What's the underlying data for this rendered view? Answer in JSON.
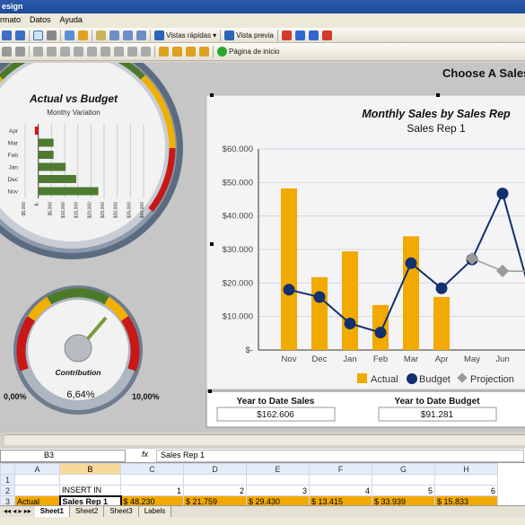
{
  "window": {
    "title": "esign"
  },
  "menu": [
    "rmato",
    "Datos",
    "Ayuda"
  ],
  "toolbar1": {
    "vistas": "Vistas rápidas",
    "vista_previa": "Vista previa"
  },
  "toolbar2": {
    "home": "Página de inicio"
  },
  "dashboard": {
    "choose_title": "Choose A Sales",
    "budget_gauge": {
      "title": "Actual vs Budget",
      "subtitle": "Monthy Variation",
      "categories": [
        "Apr",
        "Mar",
        "Feb",
        "Jan",
        "Dec",
        "Nov"
      ],
      "x_ticks": [
        "-$5,000",
        "$-",
        "$5,000",
        "$10,000",
        "$15,000",
        "$20,000",
        "$25,000",
        "$30,000",
        "$35,000",
        "$40,000"
      ],
      "values": [
        -1300,
        5800,
        5800,
        10400,
        14400,
        22800
      ]
    },
    "contribution": {
      "label": "Contribution",
      "value": "6,64%",
      "min": "0,00%",
      "max": "10,00%"
    },
    "ytd_sales": {
      "label": "Year to Date Sales",
      "value": "$162.606"
    },
    "ytd_budget": {
      "label": "Year to Date Budget",
      "value": "$91.281"
    }
  },
  "chart_data": {
    "type": "bar",
    "title": "Monthly Sales by Sales Rep",
    "subtitle": "Sales Rep 1",
    "categories": [
      "Nov",
      "Dec",
      "Jan",
      "Feb",
      "Mar",
      "Apr",
      "May",
      "Jun"
    ],
    "ylim": [
      0,
      60000
    ],
    "y_ticks": [
      "$-",
      "$10.000",
      "$20.000",
      "$30.000",
      "$40.000",
      "$50.000",
      "$60.000"
    ],
    "series": [
      {
        "name": "Actual",
        "kind": "bar",
        "color": "#f2a900",
        "values": [
          48230,
          21759,
          29430,
          13415,
          33939,
          15833,
          null,
          null
        ]
      },
      {
        "name": "Budget",
        "kind": "line",
        "color": "#12306e",
        "values": [
          18000,
          15800,
          7900,
          5200,
          25900,
          18400,
          27000,
          46700
        ]
      },
      {
        "name": "Projection",
        "kind": "line",
        "color": "#999999",
        "values": [
          null,
          null,
          null,
          null,
          null,
          null,
          27300,
          23600
        ]
      }
    ],
    "legend": "bottom"
  },
  "excel": {
    "name_box": "B3",
    "formula": "Sales Rep 1",
    "columns": [
      "A",
      "B",
      "C",
      "D",
      "E",
      "F",
      "G",
      "H"
    ],
    "rows": [
      {
        "n": "1",
        "cells": [
          "",
          "",
          "",
          "",
          "",
          "",
          "",
          ""
        ]
      },
      {
        "n": "2",
        "cells": [
          "",
          "INSERT IN",
          "1",
          "2",
          "3",
          "4",
          "5",
          "6"
        ]
      },
      {
        "n": "3",
        "cells": [
          "Actual",
          "Sales Rep 1",
          "$ 48.230",
          "$ 21.759",
          "$ 29.430",
          "$ 13.415",
          "$ 33.939",
          "$ 15.833"
        ]
      }
    ],
    "sheets": [
      "Sheet1",
      "Sheet2",
      "Sheet3",
      "Labels"
    ]
  }
}
